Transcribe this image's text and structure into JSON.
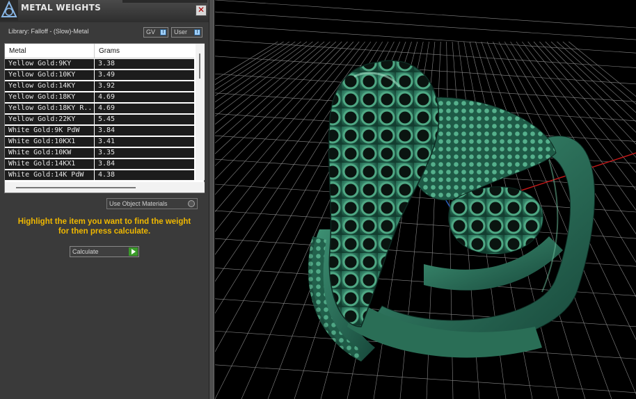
{
  "window": {
    "title": "METAL WEIGHTS",
    "close_label": "✕"
  },
  "library": {
    "label": "Library: Falloff - (Slow)-Metal"
  },
  "toggles": {
    "gv_label": "GV",
    "user_label": "User"
  },
  "table": {
    "columns": [
      "Metal",
      "Grams"
    ],
    "rows": [
      {
        "metal": "Yellow Gold:9KY",
        "grams": "3.38"
      },
      {
        "metal": "Yellow Gold:10KY",
        "grams": "3.49"
      },
      {
        "metal": "Yellow Gold:14KY",
        "grams": "3.92"
      },
      {
        "metal": "Yellow Gold:18KY",
        "grams": "4.69"
      },
      {
        "metal": "Yellow Gold:18KY R...",
        "grams": "4.69"
      },
      {
        "metal": "Yellow Gold:22KY",
        "grams": "5.45"
      },
      {
        "metal": "White Gold:9K PdW",
        "grams": "3.84"
      },
      {
        "metal": "White Gold:10KX1",
        "grams": "3.41"
      },
      {
        "metal": "White Gold:10KW",
        "grams": "3.35"
      },
      {
        "metal": "White Gold:14KX1",
        "grams": "3.84"
      },
      {
        "metal": "White Gold:14K PdW",
        "grams": "4.38"
      }
    ]
  },
  "options": {
    "use_object_materials": "Use Object Materials"
  },
  "instructions": {
    "line1": "Highlight the item you want to find the weight",
    "line2": "for then press calculate."
  },
  "actions": {
    "calculate_label": "Calculate"
  },
  "viewport": {
    "model_color": "#2e7a60",
    "grid_color": "#8a8a8a",
    "axis_x_color": "#c01818",
    "axis_y_color": "#2a60c0"
  }
}
